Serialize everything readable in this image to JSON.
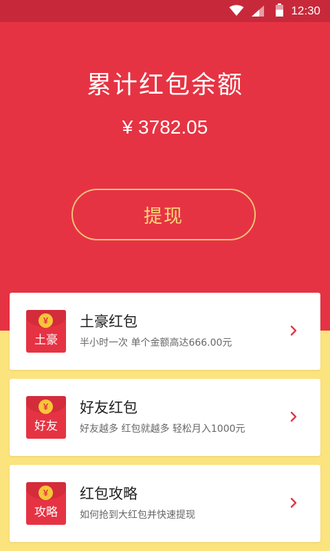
{
  "status_bar": {
    "time": "12:30",
    "icons": [
      "wifi-icon",
      "signal-icon",
      "battery-icon"
    ]
  },
  "hero": {
    "title": "累计红包余额",
    "amount": "¥ 3782.05",
    "withdraw_label": "提现"
  },
  "cards": [
    {
      "icon_text": "土豪",
      "coin": "¥",
      "title": "土豪红包",
      "subtitle": "半小时一次 单个金额高达666.00元",
      "icon": "chevron-right-icon"
    },
    {
      "icon_text": "好友",
      "coin": "¥",
      "title": "好友红包",
      "subtitle": "好友越多 红包就越多 轻松月入1000元",
      "icon": "chevron-right-icon"
    },
    {
      "icon_text": "攻略",
      "coin": "¥",
      "title": "红包攻略",
      "subtitle": "如何抢到大红包并快速提现",
      "icon": "chevron-right-icon"
    }
  ],
  "colors": {
    "status_bar": "#c8293a",
    "hero_bg": "#e63343",
    "page_bg": "#fbe37e",
    "button_border": "#f5c27a",
    "button_text": "#fbd67a",
    "coin": "#f7c53a"
  }
}
